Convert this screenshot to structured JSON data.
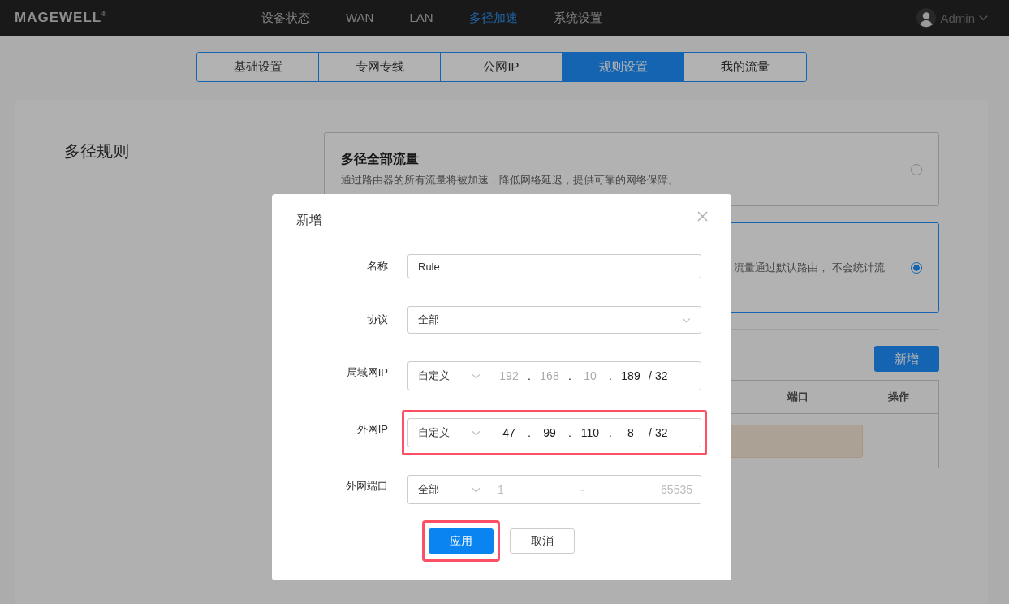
{
  "header": {
    "logo": "MAGEWELL",
    "logo_mark": "®",
    "nav": [
      {
        "label": "设备状态",
        "selected": false
      },
      {
        "label": "WAN",
        "selected": false
      },
      {
        "label": "LAN",
        "selected": false
      },
      {
        "label": "多径加速",
        "selected": true
      },
      {
        "label": "系统设置",
        "selected": false
      }
    ],
    "user": "Admin"
  },
  "tabs": [
    {
      "label": "基础设置",
      "selected": false
    },
    {
      "label": "专网专线",
      "selected": false
    },
    {
      "label": "公网IP",
      "selected": false
    },
    {
      "label": "规则设置",
      "selected": true
    },
    {
      "label": "我的流量",
      "selected": false
    }
  ],
  "section": {
    "title": "多径规则",
    "options": [
      {
        "kind": "full",
        "title": "多径全部流量",
        "description": "通过路由器的所有流量将被加速，降低网络延迟，提供可靠的网络保障。",
        "selected": false
      },
      {
        "kind": "partial",
        "description": "流量通过默认路由， 不会统计流",
        "selected": true
      }
    ],
    "add_button": "新增",
    "table": {
      "columns": [
        "端口",
        "操作"
      ]
    }
  },
  "dialog": {
    "title": "新增",
    "rows": [
      {
        "kind": "text",
        "label": "名称",
        "value": "Rule",
        "highlighted": false
      },
      {
        "kind": "select",
        "label": "协议",
        "value": "全部",
        "highlighted": false
      },
      {
        "kind": "ip",
        "label": "局域网IP",
        "mode": "自定义",
        "octets": [
          {
            "value": "192",
            "disabled": true
          },
          {
            "value": "168",
            "disabled": true
          },
          {
            "value": "10",
            "disabled": true
          },
          {
            "value": "189",
            "disabled": false
          }
        ],
        "dot": ".",
        "slash": "/",
        "mask": "32",
        "highlighted": false
      },
      {
        "kind": "ip",
        "label": "外网IP",
        "mode": "自定义",
        "octets": [
          {
            "value": "47",
            "disabled": false
          },
          {
            "value": "99",
            "disabled": false
          },
          {
            "value": "110",
            "disabled": false
          },
          {
            "value": "8",
            "disabled": false
          }
        ],
        "dot": ".",
        "slash": "/",
        "mask": "32",
        "highlighted": true
      },
      {
        "kind": "port",
        "label": "外网端口",
        "mode": "全部",
        "from": "1",
        "dash": "-",
        "to": "65535",
        "disabled": true,
        "highlighted": false
      }
    ],
    "buttons": [
      {
        "kind": "primary",
        "label": "应用",
        "highlighted": true
      },
      {
        "kind": "default",
        "label": "取消",
        "highlighted": false
      }
    ]
  }
}
